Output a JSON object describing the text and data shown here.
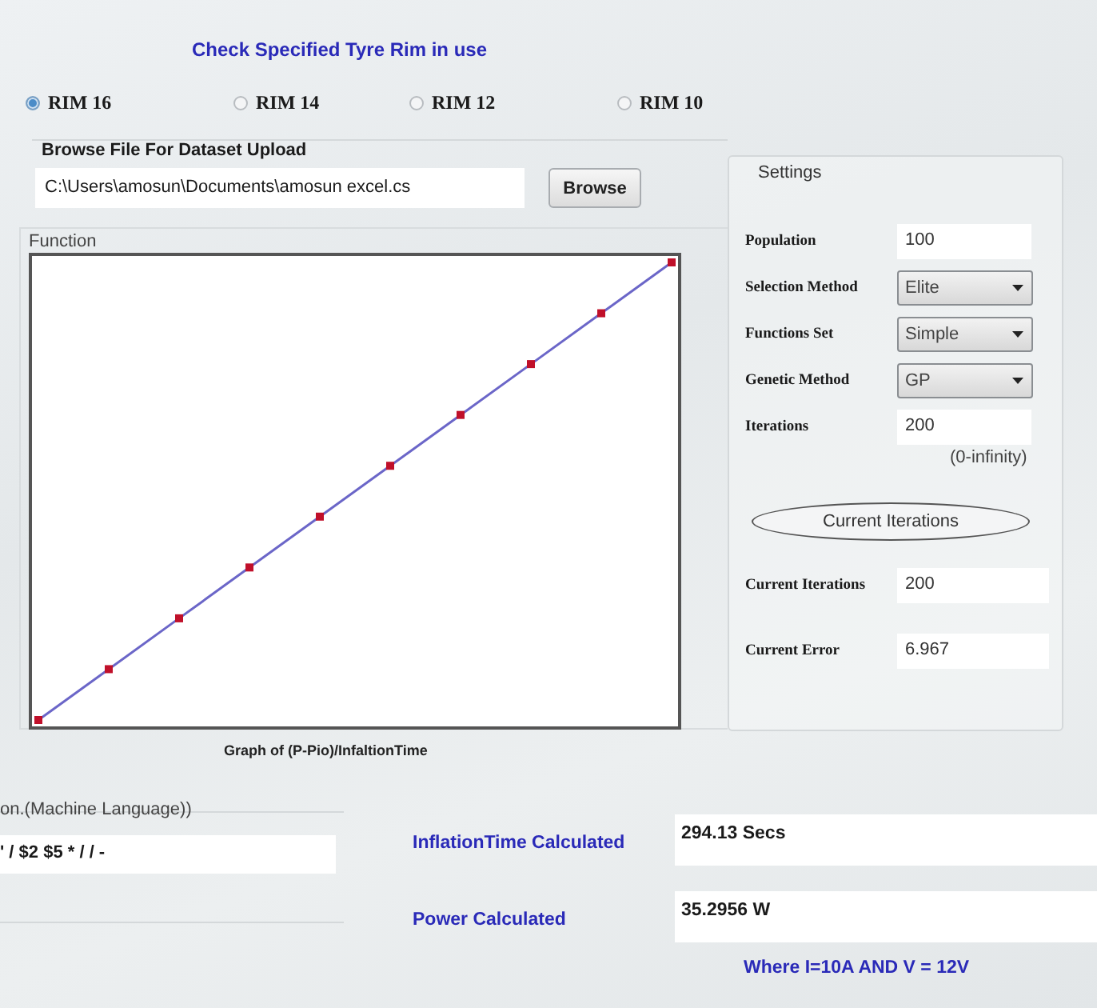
{
  "heading": "Check Specified Tyre Rim in use",
  "rims": [
    {
      "label": "RIM 16",
      "selected": true
    },
    {
      "label": "RIM 14",
      "selected": false
    },
    {
      "label": "RIM 12",
      "selected": false
    },
    {
      "label": "RIM 10",
      "selected": false
    }
  ],
  "upload": {
    "title": "Browse File For Dataset Upload",
    "path": "C:\\Users\\amosun\\Documents\\amosun excel.cs",
    "button": "Browse"
  },
  "function_panel": {
    "title": "Function",
    "caption": "Graph of (P-Pio)/InfaltionTime"
  },
  "settings": {
    "title": "Settings",
    "fields": [
      {
        "kind": "input",
        "label": "Population",
        "value": "100"
      },
      {
        "kind": "dropdown",
        "label": "Selection Method",
        "value": "Elite"
      },
      {
        "kind": "dropdown",
        "label": "Functions Set",
        "value": "Simple"
      },
      {
        "kind": "dropdown",
        "label": "Genetic Method",
        "value": "GP"
      },
      {
        "kind": "input",
        "label": "Iterations",
        "value": "200",
        "hint": "(0-infinity)"
      }
    ],
    "button": "Current Iterations",
    "outputs": [
      {
        "label": "Current Iterations",
        "value": "200"
      },
      {
        "label": "Current Error",
        "value": "6.967"
      }
    ]
  },
  "expression": {
    "title": "on.(Machine Language))",
    "value": "' / $2 $5 * / / -"
  },
  "results": [
    {
      "label": "InflationTime Calculated",
      "value": "294.13 Secs"
    },
    {
      "label": "Power Calculated",
      "value": "35.2956 W"
    }
  ],
  "note": "Where I=10A AND V = 12V"
}
